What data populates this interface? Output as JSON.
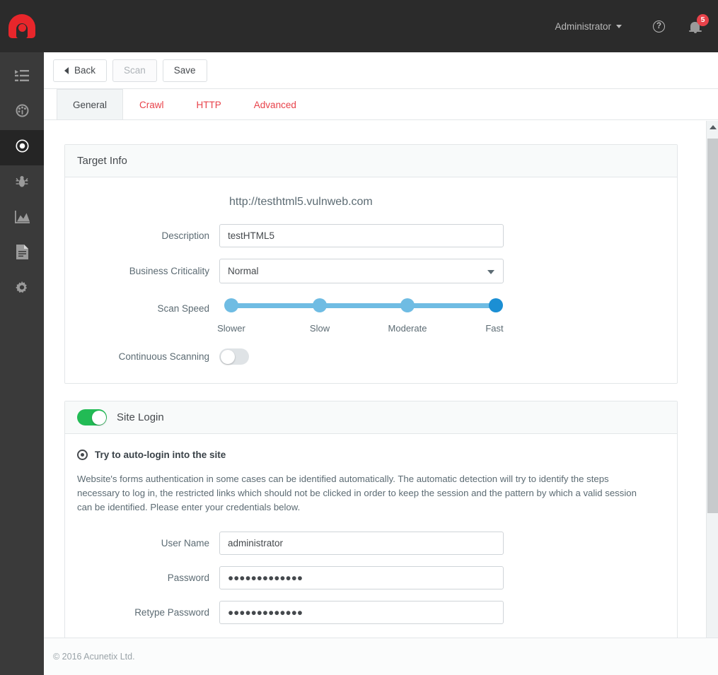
{
  "header": {
    "logo_name": "acunetix-logo",
    "user_label": "Administrator",
    "help_label": "?",
    "notification_count": "5"
  },
  "sidebar": {
    "items": [
      {
        "id": "menu",
        "icon": "list-menu-icon",
        "active": false
      },
      {
        "id": "dashboard",
        "icon": "gauge-icon",
        "active": false
      },
      {
        "id": "targets",
        "icon": "target-icon",
        "active": true
      },
      {
        "id": "vulnerabilities",
        "icon": "bug-icon",
        "active": false
      },
      {
        "id": "scans",
        "icon": "chart-icon",
        "active": false
      },
      {
        "id": "reports",
        "icon": "document-icon",
        "active": false
      },
      {
        "id": "settings",
        "icon": "gear-icon",
        "active": false
      }
    ]
  },
  "toolbar": {
    "back_label": "Back",
    "scan_label": "Scan",
    "save_label": "Save"
  },
  "tabs": [
    {
      "label": "General",
      "active": true
    },
    {
      "label": "Crawl",
      "active": false
    },
    {
      "label": "HTTP",
      "active": false
    },
    {
      "label": "Advanced",
      "active": false
    }
  ],
  "target_info": {
    "title": "Target Info",
    "url": "http://testhtml5.vulnweb.com",
    "description_label": "Description",
    "description_value": "testHTML5",
    "business_criticality_label": "Business Criticality",
    "business_criticality_value": "Normal",
    "business_criticality_options": [
      "Normal"
    ],
    "scan_speed_label": "Scan Speed",
    "scan_speed_ticks": [
      "Slower",
      "Slow",
      "Moderate",
      "Fast"
    ],
    "scan_speed_selected": "Fast",
    "scan_speed_selected_index": 3,
    "continuous_scanning_label": "Continuous Scanning",
    "continuous_scanning_on": false
  },
  "site_login": {
    "title": "Site Login",
    "enabled": true,
    "radio_label": "Try to auto-login into the site",
    "description": "Website's forms authentication in some cases can be identified automatically. The automatic detection will try to identify the steps necessary to log in, the restricted links which should not be clicked in order to keep the session and the pattern by which a valid session can be identified. Please enter your credentials below.",
    "username_label": "User Name",
    "username_value": "administrator",
    "password_label": "Password",
    "password_value": "●●●●●●●●●●●●●",
    "retype_password_label": "Retype Password",
    "retype_password_value": "●●●●●●●●●●●●●"
  },
  "footer": {
    "copyright": "© 2016 Acunetix Ltd."
  },
  "colors": {
    "brand_red": "#e8262b",
    "tab_link_red": "#e8424a",
    "slider_track": "#6fbce3",
    "slider_selected": "#1b8fd4",
    "toggle_on_green": "#22bb55",
    "topbar_dark": "#2b2b2b",
    "sidebar_dark": "#3a3a3a"
  }
}
